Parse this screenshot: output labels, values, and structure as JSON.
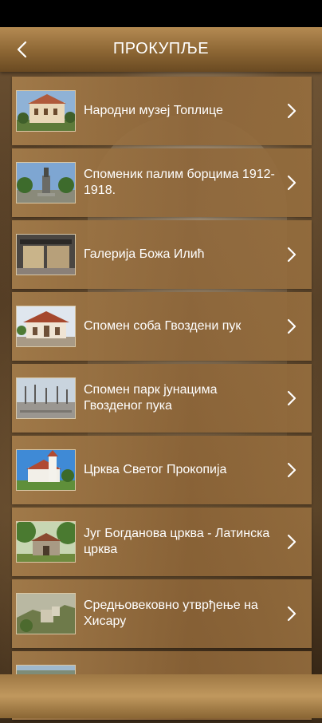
{
  "header": {
    "title": "ПРОКУПЉЕ",
    "back_icon": "chevron-left-icon"
  },
  "items": [
    {
      "label": "Народни музеј Топлице",
      "thumb": "museum-photo"
    },
    {
      "label": "Споменик палим борцима 1912-1918.",
      "thumb": "monument-photo"
    },
    {
      "label": "Галерија Божа Илић",
      "thumb": "gallery-photo"
    },
    {
      "label": "Спомен соба Гвоздени пук",
      "thumb": "memorial-room-photo"
    },
    {
      "label": "Спомен парк јунацима Гвозденог пука",
      "thumb": "memorial-park-photo"
    },
    {
      "label": "Црква Светог Прокопија",
      "thumb": "church-photo"
    },
    {
      "label": "Југ Богданова црква - Латинска црква",
      "thumb": "latin-church-photo"
    },
    {
      "label": "Средњовековно утврђење на Хисару",
      "thumb": "fortress-photo"
    },
    {
      "label": "",
      "thumb": "partial-photo"
    }
  ],
  "colors": {
    "accent": "#8c6634",
    "text": "#ffffff"
  }
}
